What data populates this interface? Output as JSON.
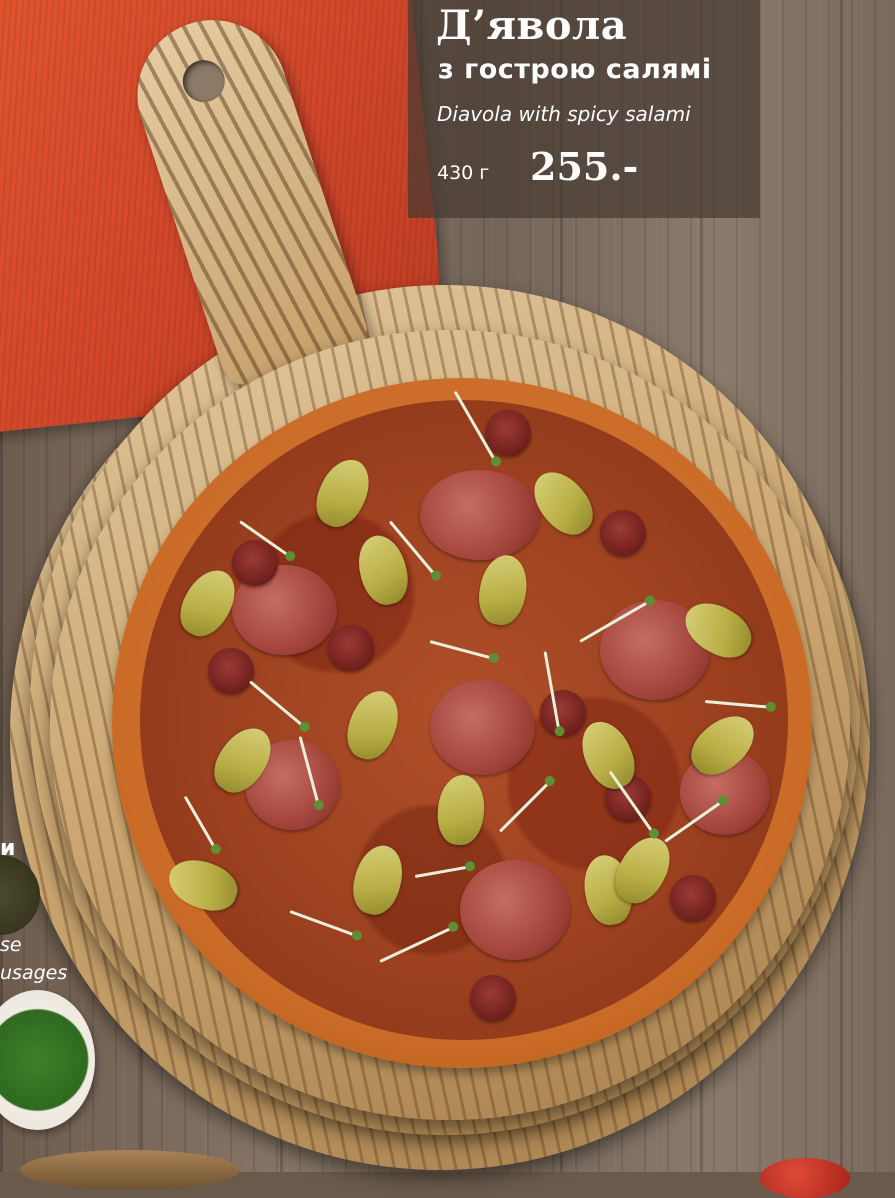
{
  "menu_item": {
    "title": "Д’явола",
    "subtitle": "з гострою салямі",
    "english_name": "Diavola with spicy salami",
    "weight": "430 г",
    "price": "255.-"
  },
  "edge_text": {
    "heading": "и",
    "line1": "se",
    "line2": "usages"
  },
  "colors": {
    "panel_bg": "#463a32",
    "text": "#ffffff",
    "napkin": "#d2472a"
  }
}
